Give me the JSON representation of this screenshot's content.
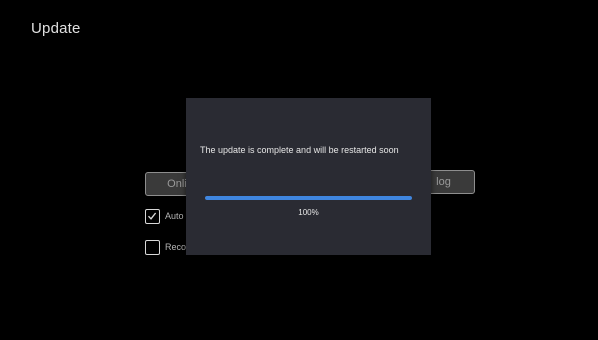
{
  "page": {
    "title": "Update"
  },
  "background": {
    "online_button_label": "Onlin",
    "log_button_label": "log",
    "auto_checkbox": {
      "label": "Auto",
      "checked": true
    },
    "recovery_checkbox": {
      "label": "Reco",
      "checked": false
    }
  },
  "dialog": {
    "message": "The update is complete and will be restarted soon",
    "progress_percent": 100,
    "progress_label": "100%"
  },
  "colors": {
    "screen_background": "#000000",
    "dialog_background": "#2a2b33",
    "progress_fill": "#3f86e0",
    "progress_track": "#4a4f5e"
  }
}
